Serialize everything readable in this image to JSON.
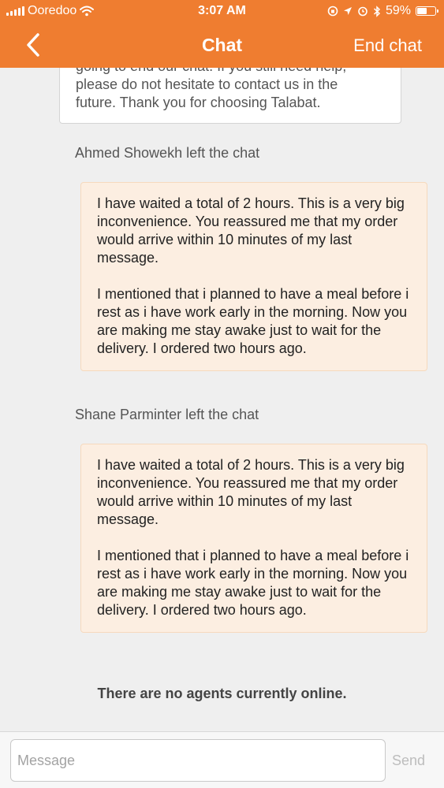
{
  "status_bar": {
    "carrier": "Ooredoo",
    "time": "3:07 AM",
    "battery_percent": "59%",
    "battery_level": 0.59,
    "icons": [
      "signal-icon",
      "wifi-icon",
      "orientation-lock-icon",
      "location-icon",
      "alarm-icon",
      "bluetooth-icon",
      "battery-icon"
    ]
  },
  "nav": {
    "title": "Chat",
    "end_chat_label": "End chat",
    "back_icon": "chevron-left-icon"
  },
  "chat": {
    "partial_message": "going to end our chat. If you still need help,\nplease do not hesitate to contact us in the\nfuture. Thank you for choosing Talabat.",
    "event_1": "Ahmed Showekh left the chat",
    "message_1": {
      "para_1": "I have waited a total of 2 hours. This is a very big inconvenience. You reassured me that my order would arrive within 10 minutes of my last message.",
      "para_2": "I mentioned that i planned to have a meal before i rest as i have work early in the morning. Now you are making me stay awake just to wait for the delivery. I ordered two hours ago."
    },
    "event_2": "Shane Parminter left the chat",
    "message_2": {
      "para_1": "I have waited a total of 2 hours. This is a very big inconvenience. You reassured me that my order would arrive within 10 minutes of my last message.",
      "para_2": "I mentioned that i planned to have a meal before i rest as i have work early in the morning. Now you are making me stay awake just to wait for the delivery. I ordered two hours ago."
    },
    "no_agents_notice": "There are no agents currently online."
  },
  "composer": {
    "placeholder": "Message",
    "value": "",
    "send_label": "Send"
  },
  "colors": {
    "accent": "#ef7d30",
    "user_bubble": "#fceee1",
    "background": "#efefef"
  }
}
